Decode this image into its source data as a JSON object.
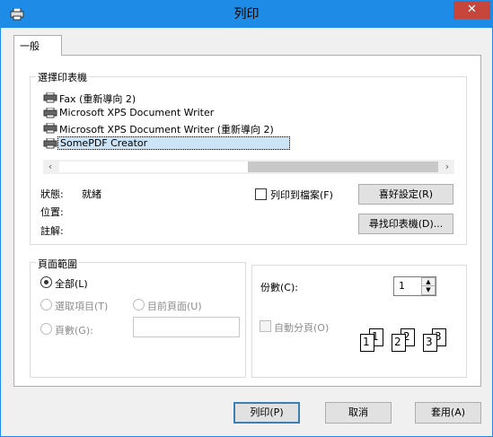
{
  "window": {
    "title": "列印",
    "close_glyph": "✕"
  },
  "tabs": [
    {
      "label": "一般"
    }
  ],
  "printer_group": {
    "legend": "選擇印表機",
    "printers": [
      {
        "name": "Fax (重新導向 2)"
      },
      {
        "name": "Microsoft XPS Document Writer"
      },
      {
        "name": "Microsoft XPS Document Writer (重新導向 2)"
      },
      {
        "name": "SomePDF Creator",
        "selected": true
      }
    ],
    "status_label": "狀態:",
    "status_value": "就緒",
    "location_label": "位置:",
    "comment_label": "註解:",
    "print_to_file_label": "列印到檔案(F)",
    "preferences_button": "喜好設定(R)",
    "find_printer_button": "尋找印表機(D)..."
  },
  "page_range": {
    "legend": "頁面範圍",
    "all_label": "全部(L)",
    "selection_label": "選取項目(T)",
    "current_page_label": "目前頁面(U)",
    "pages_label": "頁數(G):",
    "pages_value": ""
  },
  "copies": {
    "label": "份數(C):",
    "value": "1",
    "collate_label": "自動分頁(O)",
    "collate_numbers": [
      "1",
      "1",
      "2",
      "2",
      "3",
      "3"
    ]
  },
  "buttons": {
    "print": "列印(P)",
    "cancel": "取消",
    "apply": "套用(A)"
  },
  "colors": {
    "accent": "#1e8ce6",
    "close": "#c7463b",
    "selection": "#cce4f7"
  }
}
